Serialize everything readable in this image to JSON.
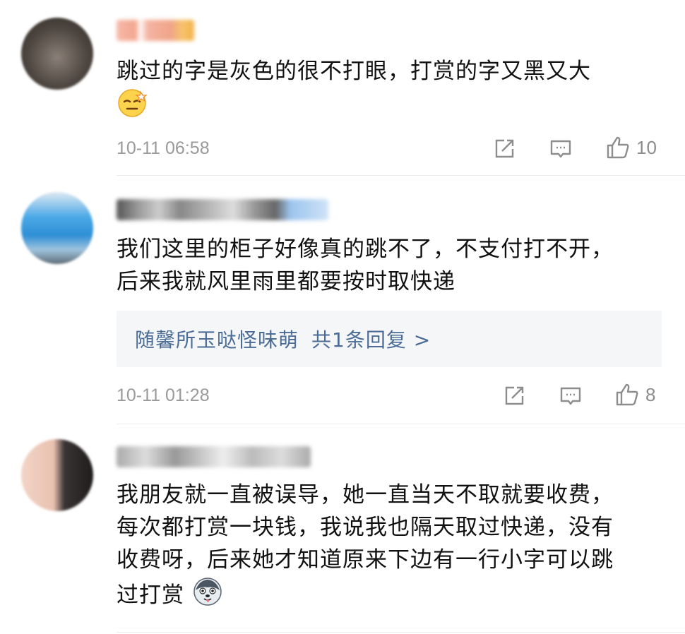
{
  "comments": [
    {
      "text_lines": [
        "跳过的字是灰色的很不打眼，打赏的字又黑又大"
      ],
      "emoji": "dizzy-face-emoji",
      "time": "10-11 06:58",
      "likes": "10"
    },
    {
      "text_lines": [
        "我们这里的柜子好像真的跳不了，不支付打不开，",
        "后来我就风里雨里都要按时取快递"
      ],
      "reply": {
        "name": "随馨所玉哒怪味萌",
        "count_text": "共1条回复 >"
      },
      "time": "10-11 01:28",
      "likes": "8"
    },
    {
      "text_lines": [
        "我朋友就一直被误导，她一直当天不取就要收费，",
        "每次都打赏一块钱，我说我也隔天取过快递，没有",
        "收费呀，后来她才知道原来下边有一行小字可以跳",
        "过打赏"
      ],
      "emoji": "husky-face-emoji"
    }
  ],
  "colors": {
    "link": "#4a6c96",
    "muted": "#9a9a9a",
    "reply_bg": "#f5f6f8"
  }
}
